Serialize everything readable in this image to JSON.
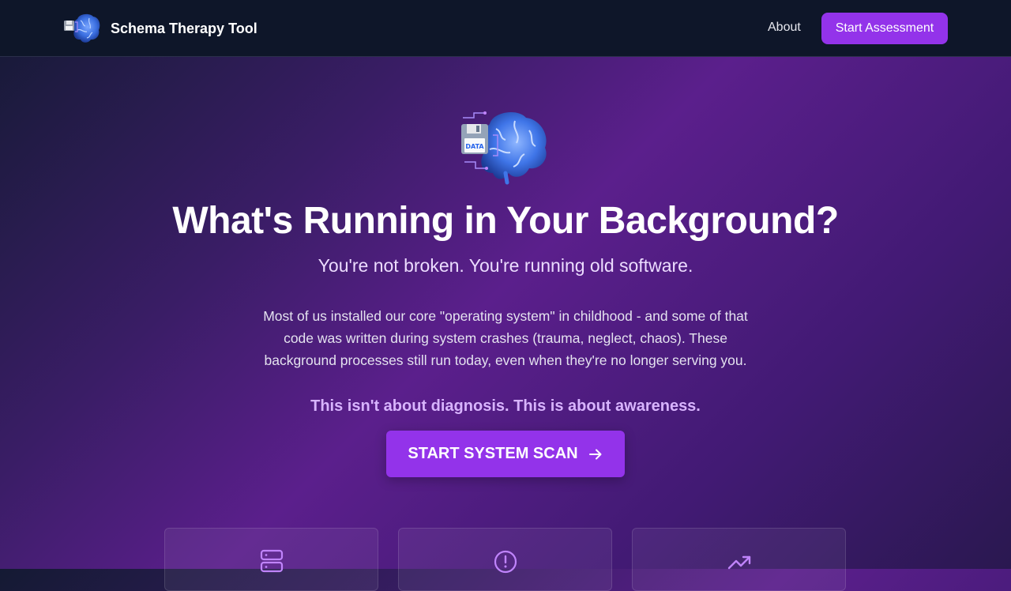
{
  "nav": {
    "app_title": "Schema Therapy Tool",
    "about_label": "About",
    "cta_label": "Start Assessment"
  },
  "hero": {
    "title": "What's Running in Your Background?",
    "subtitle": "You're not broken. You're running old software.",
    "body": "Most of us installed our core \"operating system\" in childhood - and some of that code was written during system crashes (trauma, neglect, chaos). These background processes still run today, even when they're no longer serving you.",
    "note": "This isn't about diagnosis. This is about awareness.",
    "scan_label": "START SYSTEM SCAN",
    "logo_text": "DATA"
  },
  "features": {
    "icons": [
      "server-icon",
      "alert-circle-icon",
      "trending-up-icon"
    ]
  },
  "colors": {
    "accent": "#9333ea",
    "navbar": "#0e1629",
    "highlight": "#d8b4fe",
    "icon": "#c084fc"
  }
}
